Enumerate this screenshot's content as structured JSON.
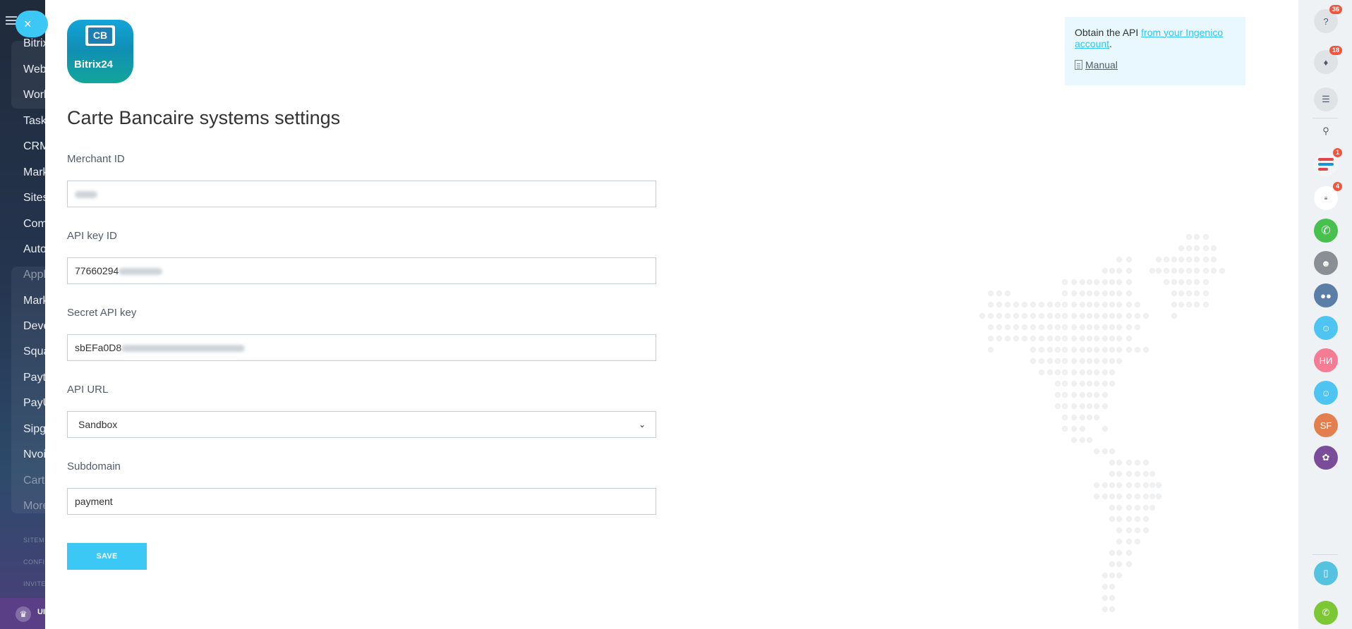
{
  "left_sidebar": {
    "items": [
      {
        "label": "Bitrix",
        "dim": false
      },
      {
        "label": "Web",
        "dim": false
      },
      {
        "label": "Work",
        "dim": false
      },
      {
        "label": "Task",
        "dim": false
      },
      {
        "label": "CRM",
        "dim": false
      },
      {
        "label": "Mark",
        "dim": false
      },
      {
        "label": "Sites",
        "dim": false
      },
      {
        "label": "Com",
        "dim": false
      },
      {
        "label": "Auto",
        "dim": false
      },
      {
        "label": "Appl",
        "dim": true
      },
      {
        "label": "Mark",
        "dim": false
      },
      {
        "label": "Deve",
        "dim": false
      },
      {
        "label": "Squa",
        "dim": false
      },
      {
        "label": "Payt",
        "dim": false
      },
      {
        "label": "PayU",
        "dim": false
      },
      {
        "label": "Sipg",
        "dim": false
      },
      {
        "label": "Nvoi",
        "dim": false
      },
      {
        "label": "Carte",
        "dim": true
      },
      {
        "label": "More",
        "dim": true
      }
    ],
    "footer_links": [
      "SITEM",
      "CONFI",
      "INVITE"
    ],
    "bottom_text": "UI"
  },
  "close_icon": "×",
  "logo": {
    "card_text": "CB",
    "brand": "Bitrix24"
  },
  "page_title": "Carte Bancaire systems settings",
  "fields": {
    "merchant_id": {
      "label": "Merchant ID",
      "value": ""
    },
    "api_key_id": {
      "label": "API key ID",
      "value": "77660294"
    },
    "secret_api_key": {
      "label": "Secret API key",
      "value": "sbEFa0D8"
    },
    "api_url": {
      "label": "API URL",
      "value": "Sandbox"
    },
    "subdomain": {
      "label": "Subdomain",
      "value": "payment"
    }
  },
  "save_label": "SAVE",
  "info": {
    "text_before": "Obtain the API ",
    "link": "from your Ingenico account",
    "text_after": ".",
    "manual": "Manual"
  },
  "right_bar": {
    "help_badge": "36",
    "notifications_badge": "18",
    "app_badge": "1",
    "avatar_badge": "4",
    "avatar_ni": "НИ",
    "avatar_sf": "SF"
  },
  "colors": {
    "accent": "#3bc8f5",
    "link": "#2fc6f6",
    "badge": "#f0553e"
  }
}
